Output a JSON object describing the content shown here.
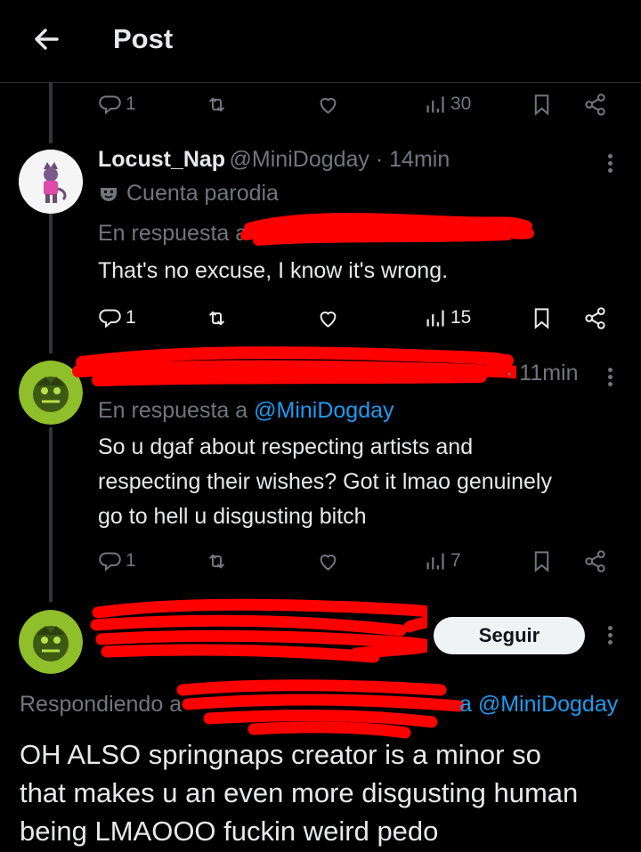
{
  "header": {
    "title": "Post"
  },
  "top_actions": {
    "replies": "1",
    "views": "30"
  },
  "post1": {
    "display_name": "Locust_Nap",
    "handle": "@MiniDogday",
    "time": " · 14min",
    "badge_text": "Cuenta parodia",
    "reply_prefix": "En respuesta a",
    "text": "That's no excuse, I know it's wrong.",
    "replies": "1",
    "views": "15"
  },
  "post2": {
    "time": "· 11min",
    "reply_prefix": "En respuesta a ",
    "reply_to": "@MiniDogday",
    "text": "So u dgaf about respecting artists and\nrespecting their wishes? Got it lmao genuinely\ngo to hell u disgusting bitch",
    "replies": "1",
    "views": "7"
  },
  "post3": {
    "follow_label": "Seguir",
    "reply_prefix": "Respondiendo a",
    "reply_to": "a @MiniDogday",
    "text": "OH ALSO springnaps creator is a minor so\nthat makes u an even more disgusting human\nbeing LMAOOO fuckin weird pedo"
  },
  "colors": {
    "link": "#1d9bf0",
    "redaction": "#ff0000",
    "muted": "#71767b"
  }
}
